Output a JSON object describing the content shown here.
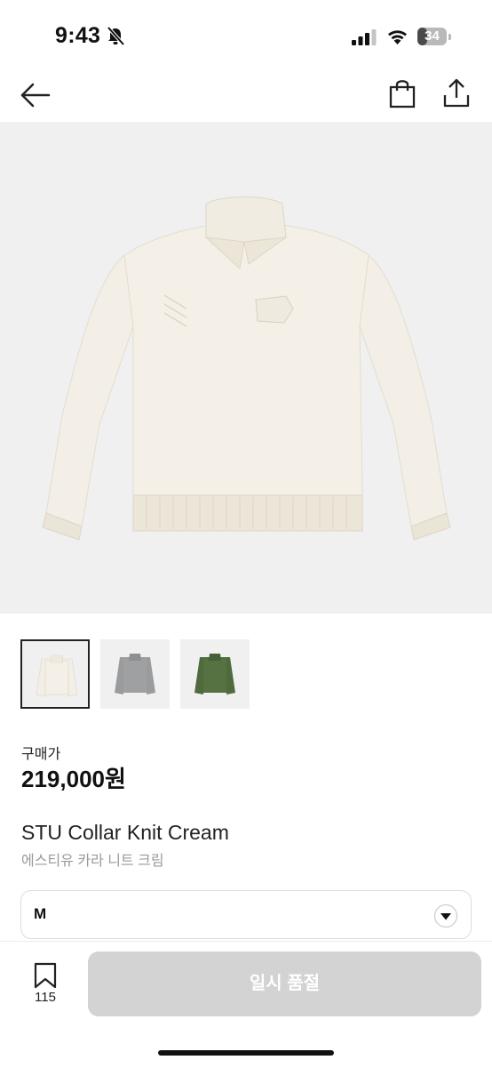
{
  "status_bar": {
    "time": "9:43",
    "battery_level": "34",
    "battery_fraction": 0.34,
    "icons": [
      "bell-slash-icon",
      "cellular-signal-icon",
      "wifi-icon",
      "battery-icon"
    ]
  },
  "nav": {
    "icons": [
      "back-arrow-icon",
      "shopping-bag-icon",
      "share-icon"
    ]
  },
  "product": {
    "image_subject": "sweater",
    "colors": {
      "cream": "#f3efe6",
      "gray": "#9a9b9d",
      "green": "#4f6a3c"
    },
    "thumbnails": [
      {
        "color": "#f3efe6",
        "selected": true
      },
      {
        "color": "#9a9b9d",
        "selected": false
      },
      {
        "color": "#4f6a3c",
        "selected": false
      }
    ],
    "price_label": "구매가",
    "price": "219,000원",
    "name_en": "STU Collar Knit Cream",
    "name_ko": "에스티유 카라 니트 크림"
  },
  "size_select": {
    "value": "M",
    "icon": "chevron-down-circle-icon"
  },
  "bottom_bar": {
    "wish_count": "115",
    "wish_icon": "bookmark-icon",
    "soldout_label": "일시 품절",
    "button_color": "#d3d3d3"
  }
}
